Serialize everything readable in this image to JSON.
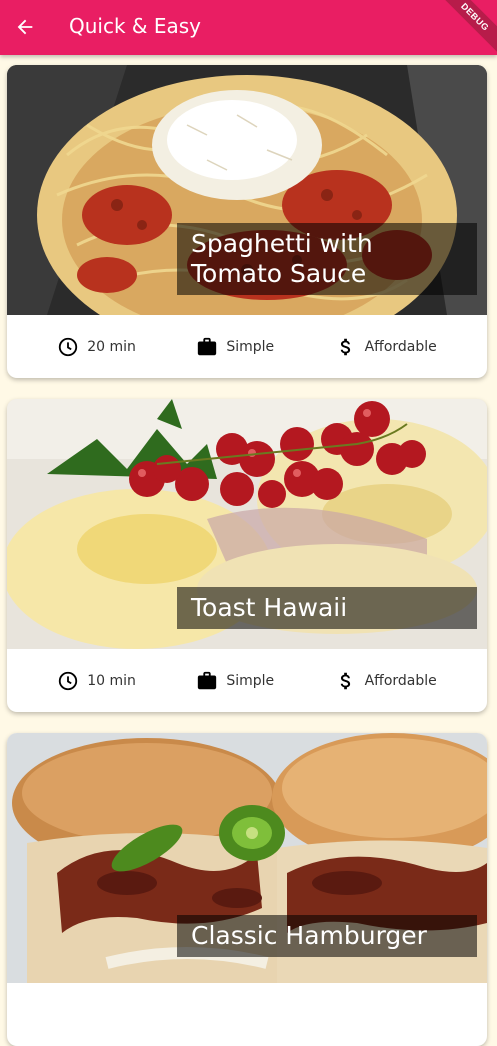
{
  "appbar": {
    "title": "Quick & Easy",
    "back_icon": "arrow-back-icon",
    "color": "#e91e63",
    "debug_label": "DEBUG"
  },
  "meals": [
    {
      "title": "Spaghetti with Tomato Sauce",
      "duration": "20 min",
      "complexity": "Simple",
      "affordability": "Affordable"
    },
    {
      "title": "Toast Hawaii",
      "duration": "10 min",
      "complexity": "Simple",
      "affordability": "Affordable"
    },
    {
      "title": "Classic Hamburger",
      "duration": "",
      "complexity": "",
      "affordability": ""
    }
  ],
  "icons": {
    "duration": "schedule-icon",
    "complexity": "work-icon",
    "affordability": "attach-money-icon"
  },
  "colors": {
    "background": "#fff9e6",
    "card": "#ffffff",
    "title_overlay": "rgba(0,0,0,0.55)"
  }
}
